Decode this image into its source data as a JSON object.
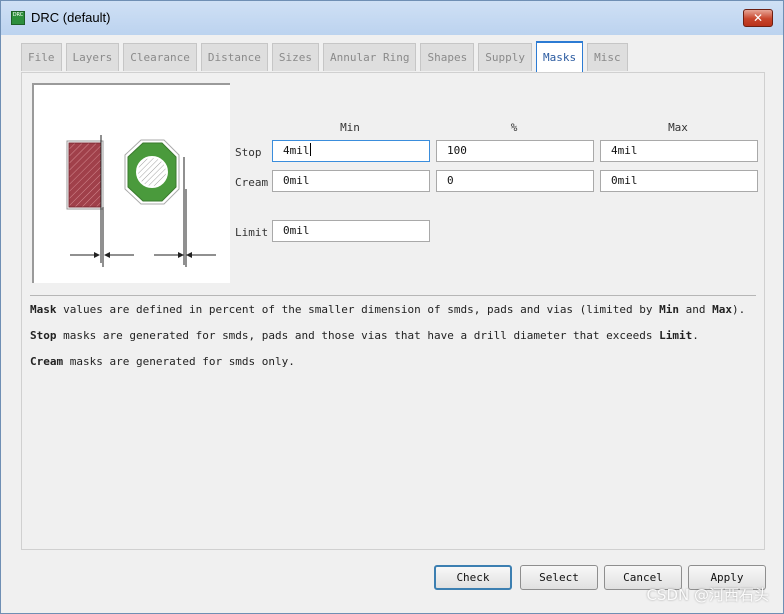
{
  "window": {
    "title": "DRC (default)",
    "icon_text": "DRC",
    "close_glyph": "✕"
  },
  "tabs": [
    {
      "label": "File",
      "active": false
    },
    {
      "label": "Layers",
      "active": false
    },
    {
      "label": "Clearance",
      "active": false
    },
    {
      "label": "Distance",
      "active": false
    },
    {
      "label": "Sizes",
      "active": false
    },
    {
      "label": "Annular Ring",
      "active": false
    },
    {
      "label": "Shapes",
      "active": false
    },
    {
      "label": "Supply",
      "active": false
    },
    {
      "label": "Masks",
      "active": true
    },
    {
      "label": "Misc",
      "active": false
    }
  ],
  "masks": {
    "columns": {
      "min": "Min",
      "percent": "%",
      "max": "Max"
    },
    "stop": {
      "label": "Stop",
      "min": "4mil",
      "percent": "100",
      "max": "4mil"
    },
    "cream": {
      "label": "Cream",
      "min": "0mil",
      "percent": "0",
      "max": "0mil"
    },
    "limit": {
      "label": "Limit",
      "value": "0mil"
    }
  },
  "description": {
    "line1": {
      "b1": "Mask",
      "t1": " values are defined in percent of the smaller dimension of smds, pads and vias (limited by ",
      "b2": "Min",
      "t2": " and ",
      "b3": "Max",
      "t3": ")."
    },
    "line2": {
      "b1": "Stop",
      "t1": " masks are generated for smds, pads and those vias that have a drill diameter that exceeds ",
      "b2": "Limit",
      "t2": "."
    },
    "line3": {
      "b1": "Cream",
      "t1": " masks are generated for smds only."
    }
  },
  "buttons": {
    "check": "Check",
    "select": "Select",
    "cancel": "Cancel",
    "apply": "Apply"
  },
  "watermark": "CSDN @河西石头",
  "colors": {
    "pad_green": "#4a9a3c",
    "smd_red": "#a0404a",
    "tab_active": "#2c7bd3"
  }
}
